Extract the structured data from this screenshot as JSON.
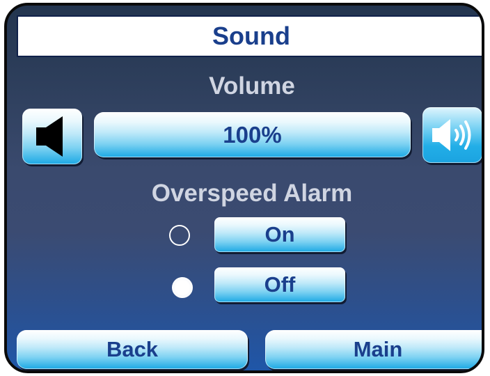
{
  "header": {
    "title": "Sound"
  },
  "volume": {
    "label": "Volume",
    "value": "100%",
    "down_icon": "speaker-icon",
    "up_icon": "speaker-loud-icon"
  },
  "alarm": {
    "label": "Overspeed Alarm",
    "options": [
      {
        "label": "On",
        "selected": false
      },
      {
        "label": "Off",
        "selected": true
      }
    ]
  },
  "nav": {
    "back_label": "Back",
    "main_label": "Main"
  },
  "colors": {
    "text_accent": "#1a3f8c",
    "label_text": "#d0d5e2",
    "button_bottom": "#1ba8e4"
  }
}
